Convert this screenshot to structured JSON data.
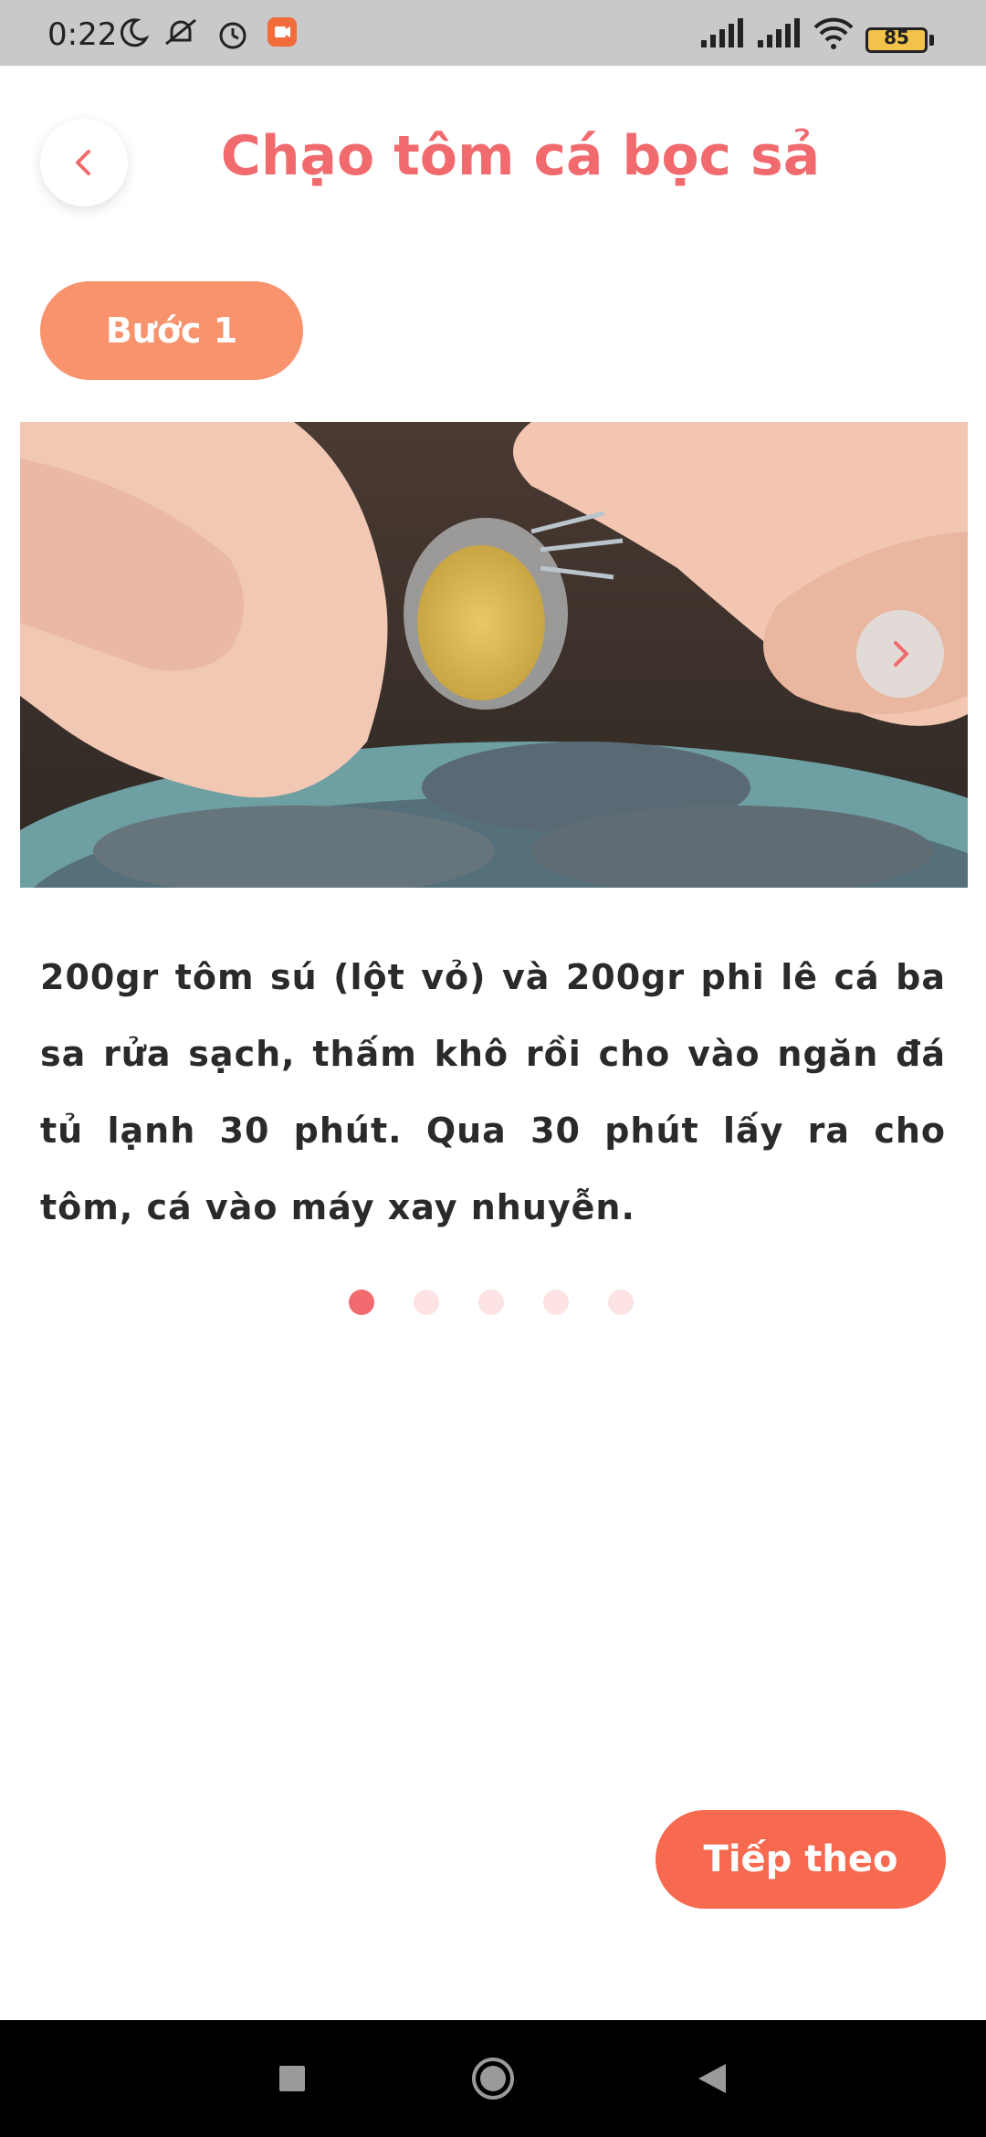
{
  "status_bar": {
    "time": "0:22",
    "battery": "85",
    "icons": [
      "moon-icon",
      "mute-icon",
      "alarm-icon",
      "app-notification-icon",
      "signal-icon",
      "signal-icon",
      "wifi-icon",
      "battery-icon"
    ]
  },
  "header": {
    "title": "Chạo tôm cá bọc sả",
    "back_icon": "chevron-left-icon"
  },
  "step": {
    "label": "Bước 1",
    "description": " 200gr tôm sú (lột vỏ) và 200gr phi lê cá ba sa rửa sạch, thấm khô rồi cho vào ngăn đá tủ lạnh 30 phút. Qua 30 phút lấy ra cho tôm, cá vào máy xay nhuyễn."
  },
  "pagination": {
    "total": 5,
    "active_index": 0
  },
  "actions": {
    "next_label": "Tiếp theo"
  },
  "colors": {
    "accent": "#f06a6e",
    "pill": "#f8936d",
    "next_button": "#f76a50"
  }
}
